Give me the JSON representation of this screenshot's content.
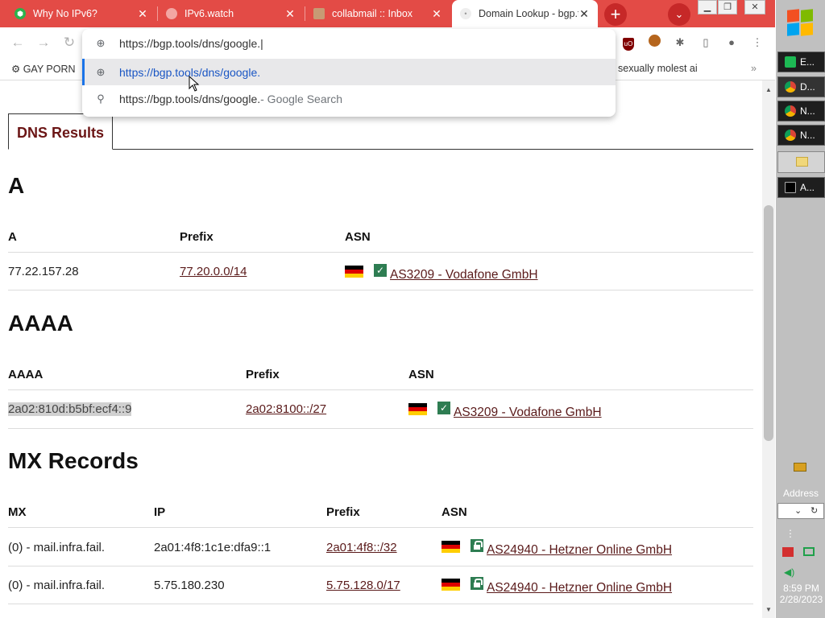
{
  "browser": {
    "tabs": [
      {
        "title": "Why No IPv6?",
        "active": false
      },
      {
        "title": "IPv6.watch",
        "active": false
      },
      {
        "title": "collabmail :: Inbox",
        "active": false
      },
      {
        "title": "Domain Lookup - bgp.tools",
        "active": true
      }
    ],
    "new_tab_label": "+",
    "bookmarks": {
      "left": "GAY PORN",
      "right": "sexually molest ai",
      "overflow": "»"
    },
    "omnibox": {
      "input_value": "https://bgp.tools/dns/google.|",
      "suggestion_url": "https://bgp.tools/dns/google.",
      "search_query": "https://bgp.tools/dns/google.",
      "search_suffix": " - Google Search"
    }
  },
  "page": {
    "tab_label": "DNS Results",
    "a_section": {
      "heading": "A",
      "headers": [
        "A",
        "Prefix",
        "ASN"
      ],
      "rows": [
        {
          "value": "77.22.157.28",
          "prefix": "77.20.0.0/14",
          "asn": "AS3209 - Vodafone GmbH",
          "badge": "check"
        }
      ]
    },
    "aaaa_section": {
      "heading": "AAAA",
      "headers": [
        "AAAA",
        "Prefix",
        "ASN"
      ],
      "rows": [
        {
          "value": "2a02:810d:b5bf:ecf4::9",
          "prefix": "2a02:8100::/27",
          "asn": "AS3209 - Vodafone GmbH",
          "badge": "check"
        }
      ]
    },
    "mx_section": {
      "heading": "MX Records",
      "headers": [
        "MX",
        "IP",
        "Prefix",
        "ASN"
      ],
      "rows": [
        {
          "mx": "(0) - mail.infra.fail.",
          "ip": "2a01:4f8:1c1e:dfa9::1",
          "prefix": "2a01:4f8::/32",
          "asn": "AS24940 - Hetzner Online GmbH",
          "badge": "lock"
        },
        {
          "mx": "(0) - mail.infra.fail.",
          "ip": "5.75.180.230",
          "prefix": "5.75.128.0/17",
          "asn": "AS24940 - Hetzner Online GmbH",
          "badge": "lock"
        }
      ]
    }
  },
  "taskbar": {
    "items": [
      "E...",
      "D...",
      "N...",
      "N...",
      "A..."
    ],
    "address_label": "Address",
    "clock_time": "8:59 PM",
    "clock_date": "2/28/2023"
  },
  "colors": {
    "tabbar": "#e34b46",
    "link": "#5a1a1a",
    "tab_heading": "#6b1515",
    "badge_green": "#2e7d52",
    "taskbar": "#c0c0c0"
  }
}
